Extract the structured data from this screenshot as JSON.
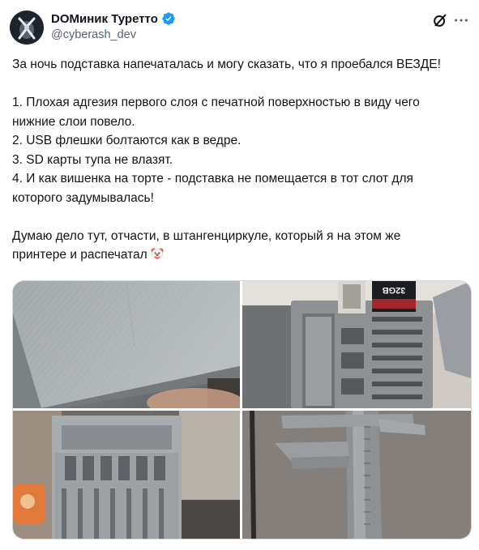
{
  "author": {
    "display_name": "DOМиник Туретто",
    "handle": "@cyberash_dev"
  },
  "post": {
    "lines": [
      "За ночь подставка напечаталась и могу сказать, что я проебался ВЕЗДЕ!",
      "",
      "1. Плохая адгезия первого слоя с печатной поверхностью в виду чего",
      "нижние слои повело.",
      "2. USB флешки болтаются как в ведре.",
      "3. SD карты тупа не влазят.",
      "4. И как вишенка на торте - подставка не помещается в тот слот для",
      "которого задумывалась!",
      "",
      "Думаю дело тут, отчасти, в штангенциркуле, который я на этом же",
      "принтере и распечатал"
    ],
    "trailing_emoji": "clown-face"
  },
  "media": {
    "photos": [
      {
        "subject": "warped-print-corner"
      },
      {
        "subject": "holder-with-usb-and-sd"
      },
      {
        "subject": "holder-slots-closeup"
      },
      {
        "subject": "printed-caliper"
      }
    ],
    "sd_card_text": "32GB"
  },
  "icons": [
    "verified-badge-icon",
    "grok-icon",
    "more-options-icon"
  ],
  "colors": {
    "text": "#0f1419",
    "secondary": "#536471",
    "verified": "#1d9bf0",
    "border": "#cfd9de"
  }
}
